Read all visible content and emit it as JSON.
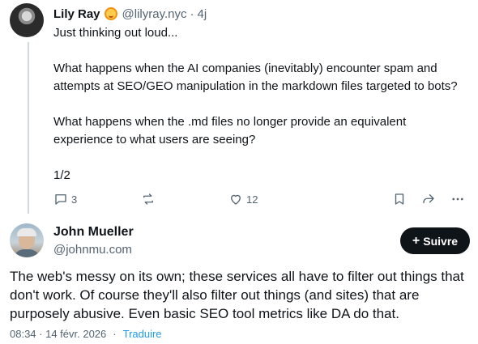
{
  "parent_post": {
    "author_name": "Lily Ray",
    "handle": "@lilyray.nyc",
    "separator": "·",
    "time": "4j",
    "badge_icon": "emoji-badge-icon",
    "text_paragraphs": [
      "Just thinking out loud...",
      "What happens when the AI companies (inevitably) encounter spam and attempts at SEO/GEO manipulation in the markdown files targeted to bots?",
      "What happens when the .md files no longer provide an equivalent experience to what users are seeing?",
      "1/2"
    ],
    "actions": {
      "reply_count": "3",
      "repost_count": "",
      "like_count": "12"
    }
  },
  "reply_post": {
    "author_name": "John Mueller",
    "handle": "@johnmu.com",
    "follow_label": "Suivre",
    "follow_plus": "+",
    "text": "The web's messy on its own; these services all have to filter out things that don't work. Of course they'll also filter out things (and sites) that are purposely abusive. Even basic SEO tool metrics like DA do that.",
    "timestamp": "08:34 · 14 févr. 2026",
    "meta_separator": "·",
    "translate_label": "Traduire"
  },
  "colors": {
    "text_primary": "#0f1419",
    "text_secondary": "#536471",
    "link": "#1d9bf0",
    "button_bg": "#0f1419",
    "thread_line": "#cfd9de"
  }
}
